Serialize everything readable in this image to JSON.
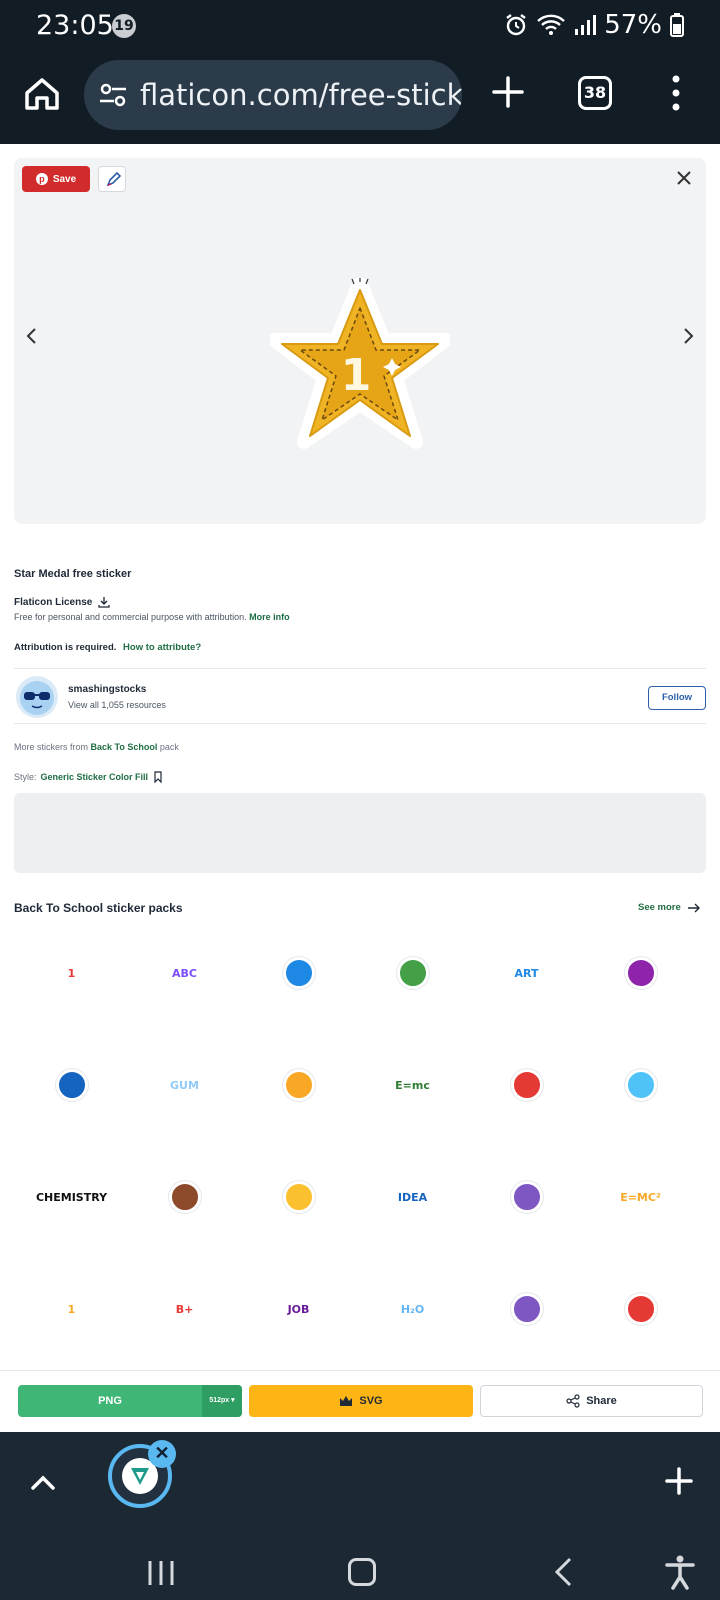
{
  "status_bar": {
    "time": "23:05",
    "notification_count": "19",
    "battery": "57%"
  },
  "browser": {
    "url": "flaticon.com/free-sticker",
    "tab_count": "38"
  },
  "viewer": {
    "save_label": "Save",
    "sticker_number": "1"
  },
  "details": {
    "title": "Star Medal free sticker",
    "license_label": "Flaticon License",
    "license_desc": "Free for personal and commercial purpose with attribution.",
    "more_info": "More info",
    "attribution_required": "Attribution is required.",
    "how_to_attribute": "How to attribute?"
  },
  "author": {
    "name": "smashingstocks",
    "resources": "View all 1,055 resources",
    "follow_label": "Follow"
  },
  "more_from": {
    "prefix": "More stickers from",
    "pack": "Back To School",
    "suffix": "pack"
  },
  "style": {
    "label": "Style:",
    "name": "Generic Sticker Color Fill"
  },
  "packs": {
    "title": "Back To School sticker packs",
    "see_more": "See more",
    "stickers": [
      {
        "name": "medal-ribbon-sticker",
        "text": "1",
        "color": "#e53935"
      },
      {
        "name": "abc-blocks-sticker",
        "text": "ABC",
        "color": "#7c4dff"
      },
      {
        "name": "alarm-clock-sticker",
        "text": "",
        "color": "#1e88e5"
      },
      {
        "name": "cactus-pot-sticker",
        "text": "",
        "color": "#43a047"
      },
      {
        "name": "art-letters-sticker",
        "text": "ART",
        "color": "#1e88e5"
      },
      {
        "name": "atom-sticker",
        "text": "",
        "color": "#8e24aa"
      },
      {
        "name": "pencils-sticker",
        "text": "",
        "color": "#1565c0"
      },
      {
        "name": "bubble-gum-sticker",
        "text": "GUM",
        "color": "#90caf9"
      },
      {
        "name": "good-job-paper-sticker",
        "text": "",
        "color": "#f9a825"
      },
      {
        "name": "chalkboard-sticker",
        "text": "E=mc",
        "color": "#2e7d32"
      },
      {
        "name": "chat-bubbles-sticker",
        "text": "",
        "color": "#e53935"
      },
      {
        "name": "weather-cloud-sticker",
        "text": "",
        "color": "#4fc3f7"
      },
      {
        "name": "chemistry-text-sticker",
        "text": "CHEMISTRY",
        "color": "#111111"
      },
      {
        "name": "clipboard-good-sticker",
        "text": "",
        "color": "#8d4a2b"
      },
      {
        "name": "paint-palette-sticker",
        "text": "",
        "color": "#fbc02d"
      },
      {
        "name": "creative-idea-sticker",
        "text": "IDEA",
        "color": "#1565c0"
      },
      {
        "name": "scissors-sticker",
        "text": "",
        "color": "#7e57c2"
      },
      {
        "name": "emc2-sticker",
        "text": "E=MC²",
        "color": "#f9a825"
      },
      {
        "name": "gold-medal-sticker",
        "text": "1",
        "color": "#f9a825"
      },
      {
        "name": "b-plus-sticker",
        "text": "B+",
        "color": "#e53935"
      },
      {
        "name": "great-job-sticker",
        "text": "JOB",
        "color": "#6a1b9a"
      },
      {
        "name": "h2o-sticker",
        "text": "H₂O",
        "color": "#64b5f6"
      },
      {
        "name": "ruler-pen-sticker",
        "text": "",
        "color": "#7e57c2"
      },
      {
        "name": "target-sticker",
        "text": "",
        "color": "#e53935"
      }
    ]
  },
  "download": {
    "png_label": "PNG",
    "png_size": "512px",
    "svg_label": "SVG",
    "share_label": "Share"
  },
  "colors": {
    "brand_green": "#3fb676",
    "accent_gold": "#fdb515",
    "link_green": "#1f6e43",
    "pinterest_red": "#d22b2b",
    "chrome_dark": "#121c25"
  }
}
